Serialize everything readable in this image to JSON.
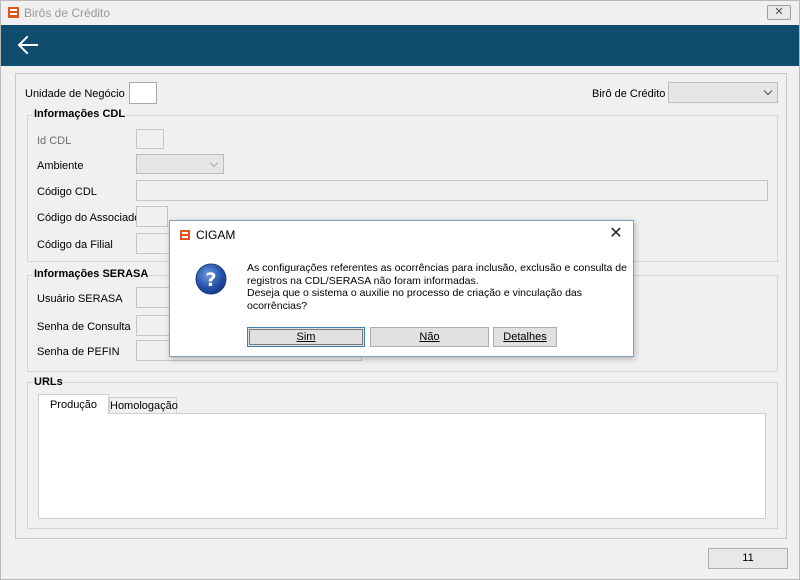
{
  "window": {
    "title": "Birôs de Crédito",
    "close_glyph": "✕"
  },
  "header": {
    "back_icon": "back-arrow-icon",
    "color": "#0f4c6e"
  },
  "form": {
    "unidade_label": "Unidade de Negócio",
    "unidade_value": "",
    "biro_label": "Birô de Crédito",
    "biro_value": ""
  },
  "cdl": {
    "title": "Informações CDL",
    "id_label": "Id CDL",
    "ambiente_label": "Ambiente",
    "codigo_cdl_label": "Código CDL",
    "codigo_associado_label": "Código do Associado",
    "codigo_filial_label": "Código da Filial"
  },
  "serasa": {
    "title": "Informações SERASA",
    "usuario_label": "Usuário SERASA",
    "senha_consulta_label": "Senha de Consulta",
    "senha_pefin_label": "Senha de PEFIN"
  },
  "urls": {
    "title": "URLs",
    "tabs": [
      "Produção",
      "Homologação"
    ],
    "active_tab": "Produção"
  },
  "status": {
    "value": "11"
  },
  "dialog": {
    "title": "CIGAM",
    "icon": "question-icon",
    "message_lines": [
      "As configurações referentes as ocorrências para inclusão, exclusão e consulta de",
      "registros na CDL/SERASA não foram informadas.",
      "Deseja que o sistema o auxilie no processo de criação e vinculação das",
      "ocorrências?"
    ],
    "buttons": {
      "sim": "Sim",
      "nao": "Não",
      "detalhes": "Detalhes"
    }
  }
}
